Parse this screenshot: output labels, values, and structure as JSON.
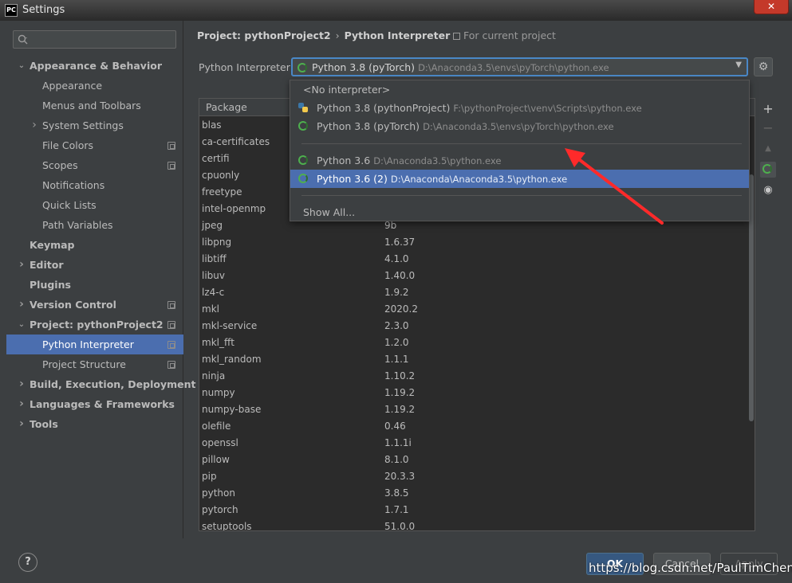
{
  "window": {
    "title": "Settings",
    "app_icon": "PC",
    "close_label": "✕"
  },
  "sidebar": {
    "search_placeholder": "",
    "items": [
      {
        "label": "Appearance & Behavior",
        "bold": true,
        "level": 0,
        "arrow": "expanded"
      },
      {
        "label": "Appearance",
        "bold": false,
        "level": 1,
        "arrow": "none"
      },
      {
        "label": "Menus and Toolbars",
        "bold": false,
        "level": 1,
        "arrow": "none"
      },
      {
        "label": "System Settings",
        "bold": false,
        "level": 1,
        "arrow": "collapsed"
      },
      {
        "label": "File Colors",
        "bold": false,
        "level": 1,
        "arrow": "none",
        "copy_icon": true
      },
      {
        "label": "Scopes",
        "bold": false,
        "level": 1,
        "arrow": "none",
        "copy_icon": true
      },
      {
        "label": "Notifications",
        "bold": false,
        "level": 1,
        "arrow": "none"
      },
      {
        "label": "Quick Lists",
        "bold": false,
        "level": 1,
        "arrow": "none"
      },
      {
        "label": "Path Variables",
        "bold": false,
        "level": 1,
        "arrow": "none"
      },
      {
        "label": "Keymap",
        "bold": true,
        "level": 0,
        "arrow": "none"
      },
      {
        "label": "Editor",
        "bold": true,
        "level": 0,
        "arrow": "collapsed"
      },
      {
        "label": "Plugins",
        "bold": true,
        "level": 0,
        "arrow": "none"
      },
      {
        "label": "Version Control",
        "bold": true,
        "level": 0,
        "arrow": "collapsed",
        "copy_icon": true
      },
      {
        "label": "Project: pythonProject2",
        "bold": true,
        "level": 0,
        "arrow": "expanded",
        "copy_icon": true
      },
      {
        "label": "Python Interpreter",
        "bold": false,
        "level": 1,
        "arrow": "none",
        "copy_icon": true,
        "selected": true
      },
      {
        "label": "Project Structure",
        "bold": false,
        "level": 1,
        "arrow": "none",
        "copy_icon": true
      },
      {
        "label": "Build, Execution, Deployment",
        "bold": true,
        "level": 0,
        "arrow": "collapsed"
      },
      {
        "label": "Languages & Frameworks",
        "bold": true,
        "level": 0,
        "arrow": "collapsed"
      },
      {
        "label": "Tools",
        "bold": true,
        "level": 0,
        "arrow": "collapsed"
      }
    ]
  },
  "breadcrumb": {
    "project": "Project: pythonProject2",
    "separator": "›",
    "page": "Python Interpreter"
  },
  "current_project_label": "For current project",
  "interpreter": {
    "label": "Python Interpreter:",
    "selected_name": "Python 3.8 (pyTorch)",
    "selected_path": "D:\\Anaconda3.5\\envs\\pyTorch\\python.exe"
  },
  "dropdown": {
    "no_interpreter": "<No interpreter>",
    "options": [
      {
        "name": "Python 3.8 (pythonProject)",
        "path": "F:\\pythonProject\\venv\\Scripts\\python.exe",
        "icon": "python-icon"
      },
      {
        "name": "Python 3.8 (pyTorch)",
        "path": "D:\\Anaconda3.5\\envs\\pyTorch\\python.exe",
        "icon": "conda-ring-icon"
      },
      {
        "name": "Python 3.6",
        "path": "D:\\Anaconda3.5\\python.exe",
        "icon": "conda-ring-icon"
      },
      {
        "name": "Python 3.6 (2)",
        "path": "D:\\Anaconda\\Anaconda3.5\\python.exe",
        "icon": "conda-ring-icon",
        "selected": true
      }
    ],
    "show_all": "Show All..."
  },
  "packages": {
    "header_package": "Package",
    "rows": [
      {
        "name": "blas",
        "version": ""
      },
      {
        "name": "ca-certificates",
        "version": ""
      },
      {
        "name": "certifi",
        "version": ""
      },
      {
        "name": "cpuonly",
        "version": ""
      },
      {
        "name": "freetype",
        "version": ""
      },
      {
        "name": "intel-openmp",
        "version": ""
      },
      {
        "name": "jpeg",
        "version": "9b"
      },
      {
        "name": "libpng",
        "version": "1.6.37"
      },
      {
        "name": "libtiff",
        "version": "4.1.0"
      },
      {
        "name": "libuv",
        "version": "1.40.0"
      },
      {
        "name": "lz4-c",
        "version": "1.9.2"
      },
      {
        "name": "mkl",
        "version": "2020.2"
      },
      {
        "name": "mkl-service",
        "version": "2.3.0"
      },
      {
        "name": "mkl_fft",
        "version": "1.2.0"
      },
      {
        "name": "mkl_random",
        "version": "1.1.1"
      },
      {
        "name": "ninja",
        "version": "1.10.2"
      },
      {
        "name": "numpy",
        "version": "1.19.2"
      },
      {
        "name": "numpy-base",
        "version": "1.19.2"
      },
      {
        "name": "olefile",
        "version": "0.46"
      },
      {
        "name": "openssl",
        "version": "1.1.1i"
      },
      {
        "name": "pillow",
        "version": "8.1.0"
      },
      {
        "name": "pip",
        "version": "20.3.3"
      },
      {
        "name": "python",
        "version": "3.8.5"
      },
      {
        "name": "pytorch",
        "version": "1.7.1"
      },
      {
        "name": "setuptools",
        "version": "51.0.0"
      }
    ]
  },
  "side_tools": {
    "add": "+",
    "remove": "−",
    "upgrade": "▲",
    "eye": "◉"
  },
  "buttons": {
    "help": "?",
    "ok": "OK",
    "cancel": "Cancel",
    "apply": "Apply"
  },
  "watermark": "https://blog.csdn.net/PaulTimChen",
  "colors": {
    "accent": "#4b6eaf",
    "focus_border": "#4a88c7",
    "annotation_arrow": "#ff2a2a"
  }
}
